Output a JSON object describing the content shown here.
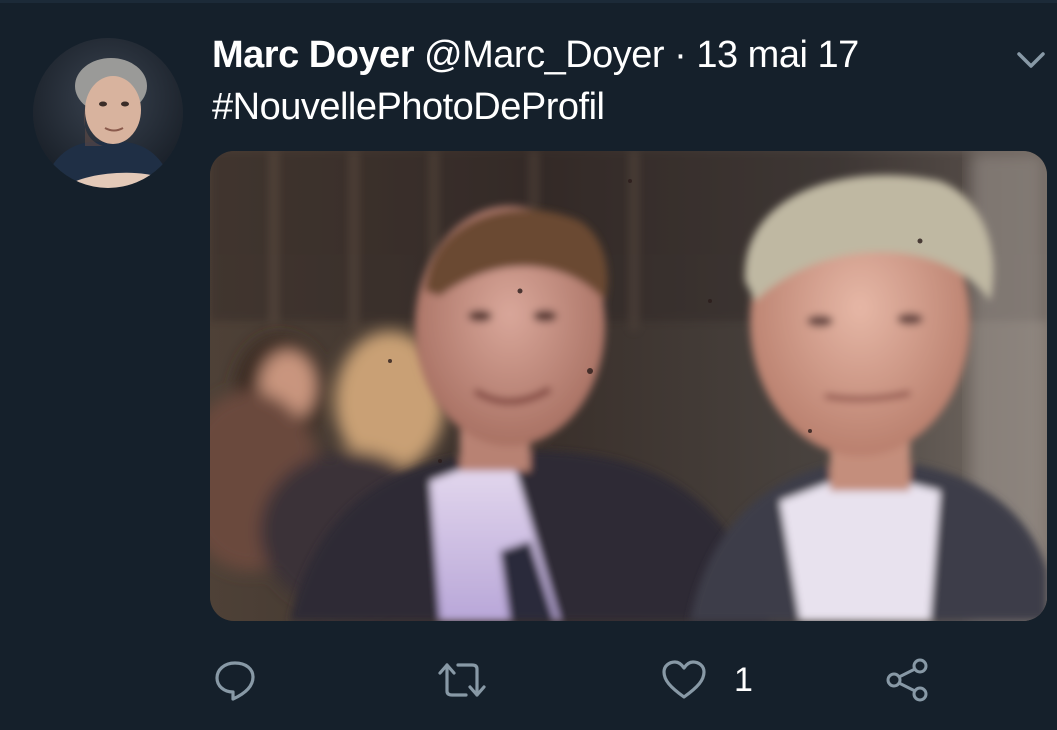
{
  "tweet": {
    "author_name": "Marc Doyer",
    "handle": "@Marc_Doyer",
    "separator": "·",
    "date": "13 mai 17",
    "text": "#NouvellePhotoDeProfil"
  },
  "actions": {
    "like_count": "1",
    "reply_icon": "reply-icon",
    "retweet_icon": "retweet-icon",
    "like_icon": "heart-icon",
    "share_icon": "share-icon"
  },
  "menu": {
    "icon": "chevron-down-icon"
  },
  "colors": {
    "background": "#15202b",
    "icon": "#8899a6",
    "text": "#ffffff"
  }
}
